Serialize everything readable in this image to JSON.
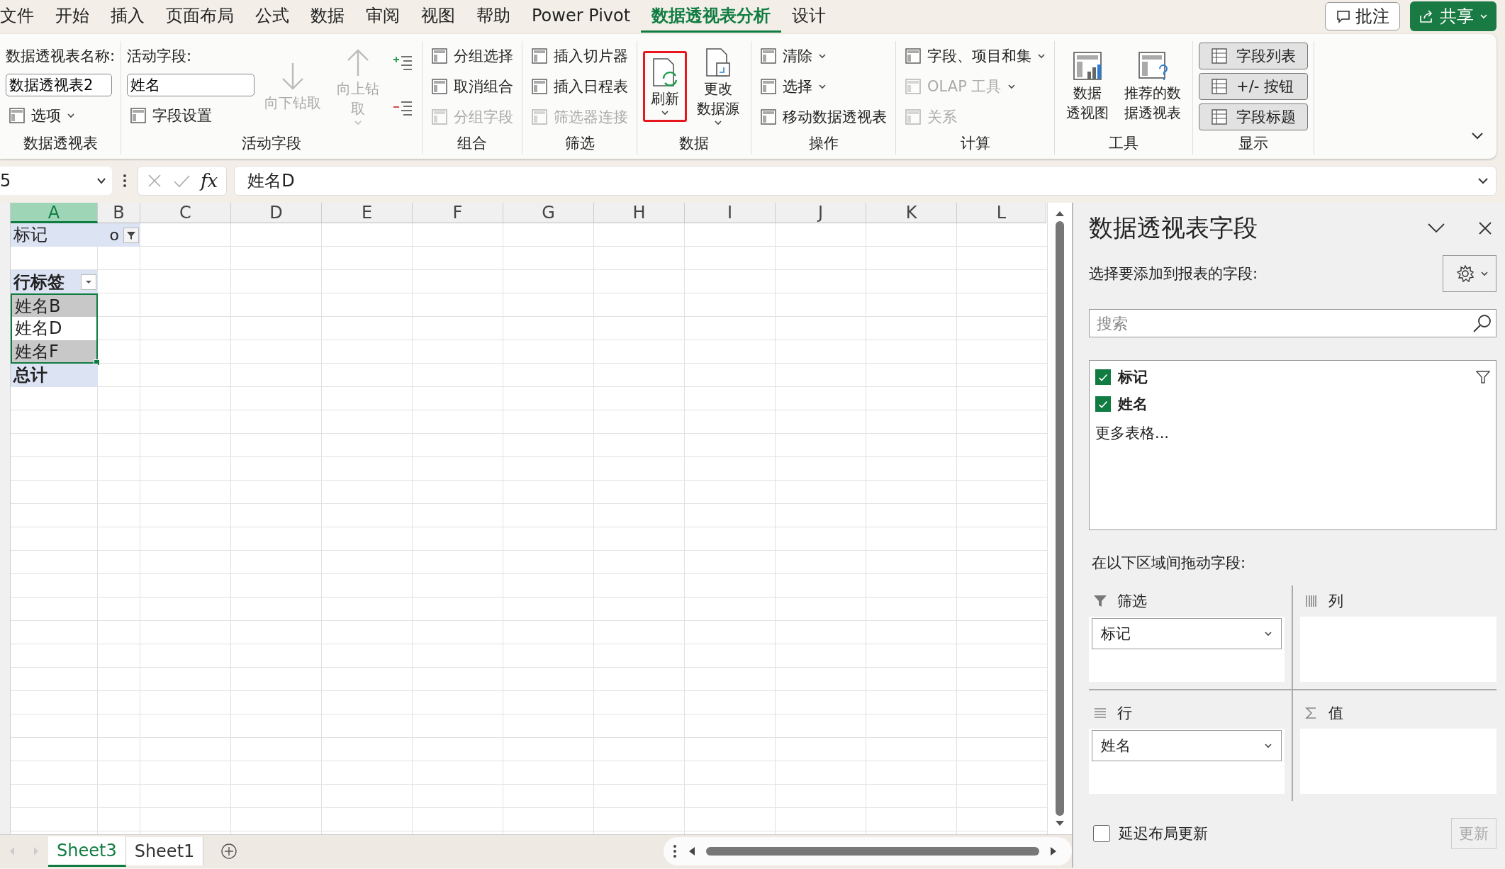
{
  "ribbon_tabs": [
    {
      "label": "文件",
      "selected": false
    },
    {
      "label": "开始",
      "selected": false
    },
    {
      "label": "插入",
      "selected": false
    },
    {
      "label": "页面布局",
      "selected": false
    },
    {
      "label": "公式",
      "selected": false
    },
    {
      "label": "数据",
      "selected": false
    },
    {
      "label": "审阅",
      "selected": false
    },
    {
      "label": "视图",
      "selected": false
    },
    {
      "label": "帮助",
      "selected": false
    },
    {
      "label": "Power Pivot",
      "selected": false
    },
    {
      "label": "数据透视表分析",
      "selected": true
    },
    {
      "label": "设计",
      "selected": false
    }
  ],
  "comment_button": "批注",
  "share_button": "共享",
  "ribbon_groups": [
    {
      "label": "数据透视表",
      "columns": [
        [
          {
            "kind": "caption",
            "label": "数据透视表名称:"
          },
          {
            "kind": "input",
            "value": "数据透视表2"
          },
          {
            "kind": "button",
            "label": "选项",
            "dropdown": true,
            "disabled": false
          }
        ]
      ]
    },
    {
      "label": "活动字段",
      "columns": [
        [
          {
            "kind": "caption",
            "label": "活动字段:"
          },
          {
            "kind": "input",
            "value": "姓名"
          },
          {
            "kind": "button",
            "label": "字段设置",
            "dropdown": false,
            "disabled": false
          }
        ],
        [
          {
            "kind": "big",
            "lines": [
              "向下钻取"
            ],
            "dropdown": false,
            "disabled": true,
            "highlighted": false
          }
        ],
        [
          {
            "kind": "big",
            "lines": [
              "向上钻",
              "取"
            ],
            "dropdown": true,
            "disabled": true,
            "highlighted": false
          }
        ],
        [
          {
            "kind": "tool"
          },
          {
            "kind": "tool"
          }
        ]
      ]
    },
    {
      "label": "组合",
      "columns": [
        [
          {
            "kind": "button",
            "label": "分组选择",
            "dropdown": false,
            "disabled": false
          },
          {
            "kind": "button",
            "label": "取消组合",
            "dropdown": false,
            "disabled": false
          },
          {
            "kind": "button",
            "label": "分组字段",
            "dropdown": false,
            "disabled": true
          }
        ]
      ]
    },
    {
      "label": "筛选",
      "columns": [
        [
          {
            "kind": "button",
            "label": "插入切片器",
            "dropdown": false,
            "disabled": false
          },
          {
            "kind": "button",
            "label": "插入日程表",
            "dropdown": false,
            "disabled": false
          },
          {
            "kind": "button",
            "label": "筛选器连接",
            "dropdown": false,
            "disabled": true
          }
        ]
      ]
    },
    {
      "label": "数据",
      "columns": [
        [
          {
            "kind": "big",
            "lines": [
              "刷新"
            ],
            "dropdown": true,
            "disabled": false,
            "highlighted": true
          }
        ],
        [
          {
            "kind": "big",
            "lines": [
              "更改",
              "数据源"
            ],
            "dropdown": true,
            "disabled": false,
            "highlighted": false
          }
        ]
      ]
    },
    {
      "label": "操作",
      "columns": [
        [
          {
            "kind": "button",
            "label": "清除",
            "dropdown": true,
            "disabled": false
          },
          {
            "kind": "button",
            "label": "选择",
            "dropdown": true,
            "disabled": false
          },
          {
            "kind": "button",
            "label": "移动数据透视表",
            "dropdown": false,
            "disabled": false
          }
        ]
      ]
    },
    {
      "label": "计算",
      "columns": [
        [
          {
            "kind": "button",
            "label": "字段、项目和集",
            "dropdown": true,
            "disabled": false
          },
          {
            "kind": "button",
            "label": "OLAP 工具",
            "dropdown": true,
            "disabled": true
          },
          {
            "kind": "button",
            "label": "关系",
            "dropdown": false,
            "disabled": true
          }
        ]
      ]
    },
    {
      "label": "工具",
      "columns": [
        [
          {
            "kind": "big",
            "lines": [
              "数据",
              "透视图"
            ],
            "dropdown": false,
            "disabled": false,
            "highlighted": false
          }
        ],
        [
          {
            "kind": "big",
            "lines": [
              "推荐的数",
              "据透视表"
            ],
            "dropdown": false,
            "disabled": false,
            "highlighted": false
          }
        ]
      ]
    },
    {
      "label": "显示",
      "columns": [
        [
          {
            "kind": "toggle",
            "label": "字段列表",
            "on": true
          },
          {
            "kind": "toggle",
            "label": "+/- 按钮",
            "on": true
          },
          {
            "kind": "toggle",
            "label": "字段标题",
            "on": true
          }
        ]
      ]
    }
  ],
  "formula_bar": {
    "name_box": "5",
    "function_label": "fx",
    "formula": "姓名D"
  },
  "columns": [
    {
      "label": "A",
      "selected": true
    },
    {
      "label": "B",
      "selected": false
    },
    {
      "label": "C",
      "selected": false
    },
    {
      "label": "D",
      "selected": false
    },
    {
      "label": "E",
      "selected": false
    },
    {
      "label": "F",
      "selected": false
    },
    {
      "label": "G",
      "selected": false
    },
    {
      "label": "H",
      "selected": false
    },
    {
      "label": "I",
      "selected": false
    },
    {
      "label": "J",
      "selected": false
    },
    {
      "label": "K",
      "selected": false
    },
    {
      "label": "L",
      "selected": false
    }
  ],
  "pivot": {
    "filter_field": "标记",
    "filter_value": "o",
    "row_header": "行标签",
    "rows": [
      {
        "label": "姓名B",
        "active": false
      },
      {
        "label": "姓名D",
        "active": true
      },
      {
        "label": "姓名F",
        "active": false
      }
    ],
    "total": "总计"
  },
  "sheet_tabs": [
    {
      "label": "Sheet3",
      "selected": true
    },
    {
      "label": "Sheet1",
      "selected": false
    }
  ],
  "pane": {
    "title": "数据透视表字段",
    "subtitle": "选择要添加到报表的字段:",
    "search_placeholder": "搜索",
    "fields": [
      {
        "label": "标记",
        "checked": true,
        "filtered": true
      },
      {
        "label": "姓名",
        "checked": true,
        "filtered": false
      }
    ],
    "more_tables": "更多表格...",
    "areas_label": "在以下区域间拖动字段:",
    "areas": [
      {
        "kind": "filter",
        "label": "筛选",
        "items": [
          "标记"
        ]
      },
      {
        "kind": "columns",
        "label": "列"
      },
      {
        "kind": "rows",
        "label": "行",
        "items": [
          "姓名"
        ]
      },
      {
        "kind": "values",
        "label": "值"
      }
    ],
    "defer_update": {
      "label": "延迟布局更新",
      "checked": false
    },
    "update_button": {
      "label": "更新",
      "disabled": true
    }
  }
}
